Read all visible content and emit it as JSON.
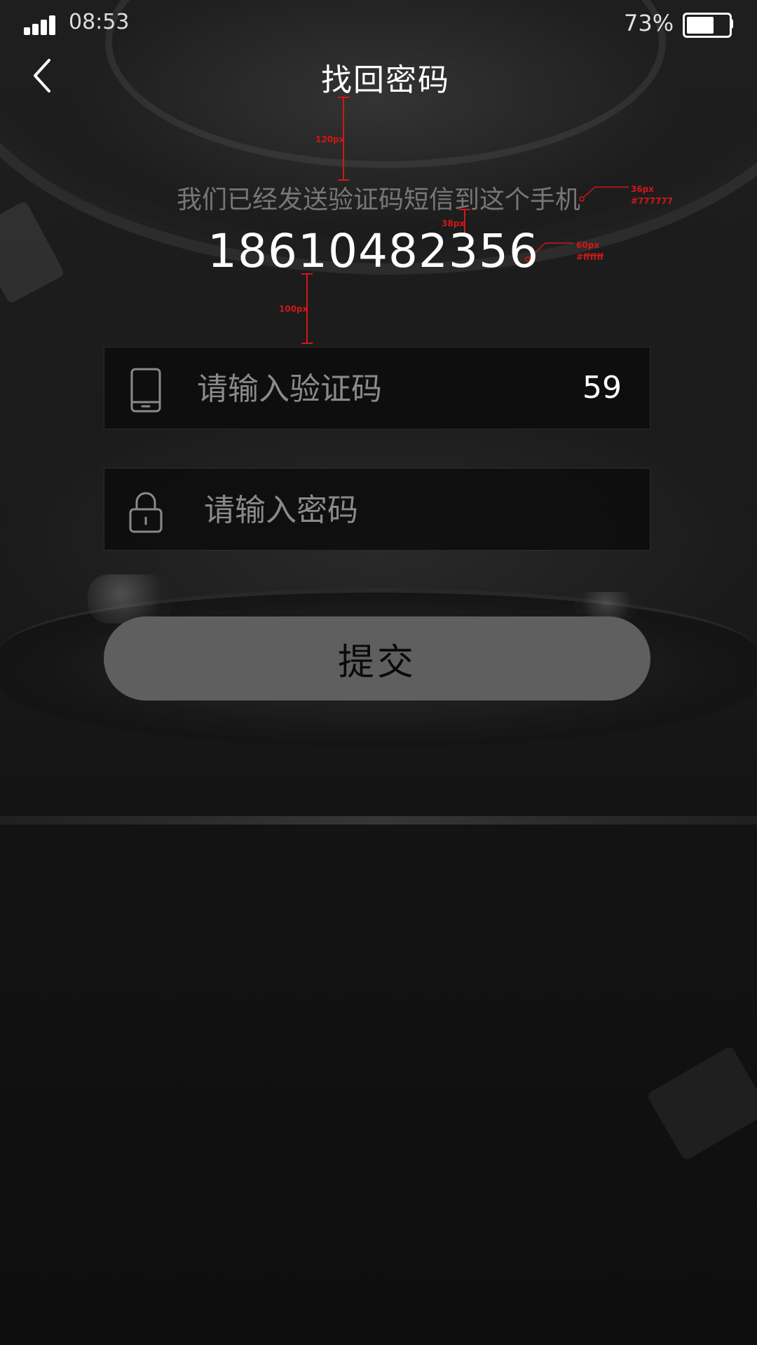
{
  "status_bar": {
    "time": "08:53",
    "battery_percent": "73%",
    "battery_level": 0.73,
    "signal_bars": 4
  },
  "header": {
    "title": "找回密码",
    "back_icon": "chevron-left-icon"
  },
  "message": {
    "sent_text": "我们已经发送验证码短信到这个手机",
    "phone": "18610482356"
  },
  "form": {
    "code": {
      "icon": "phone-icon",
      "placeholder": "请输入验证码",
      "countdown": "59"
    },
    "password": {
      "icon": "lock-icon",
      "placeholder": "请输入密码"
    },
    "submit_label": "提交"
  },
  "annotations": {
    "title_gap": "120px",
    "message_gap": "38px",
    "phone_gap": "100px",
    "message_size": "36px",
    "message_color": "#777777",
    "phone_size": "60px",
    "phone_color": "#ffffff"
  },
  "colors": {
    "message_text": "#777777",
    "phone_text": "#ffffff",
    "button_bg": "#5f5f5f",
    "annotation": "#d01818"
  }
}
